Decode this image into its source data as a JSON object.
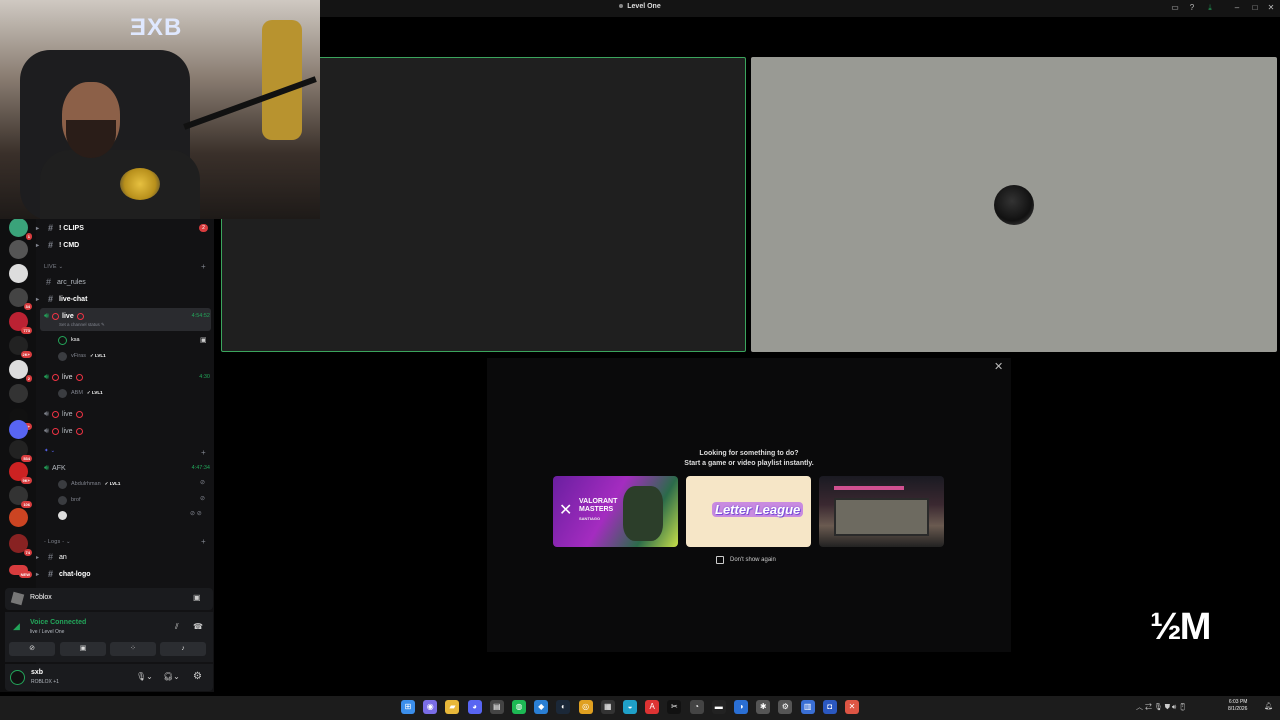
{
  "window": {
    "title": "Level One"
  },
  "webcam": {
    "logo_text": "ƎXB"
  },
  "channels": {
    "clips": "! CLIPS",
    "clips_badge": "2",
    "cmd": "! CMD",
    "live_category": "LIVE",
    "arc_rules": "arc_rules",
    "live_chat": "live-chat",
    "voice1": {
      "name": "live",
      "status": "Set a channel status",
      "time": "4:54:52",
      "users": [
        {
          "name": "ksa"
        },
        {
          "name": "vFiras",
          "level": "LVL1"
        }
      ]
    },
    "voice2": {
      "name": "live",
      "time": "4:30",
      "users": [
        {
          "name": "ABM",
          "level": "LVL1"
        }
      ]
    },
    "voice3": {
      "name": "live"
    },
    "voice4": {
      "name": "live"
    },
    "afk": {
      "name": "AFK",
      "time": "4:47:34",
      "users": [
        {
          "name": "Abdulrhman",
          "level": "LVL1"
        },
        {
          "name": "brof"
        }
      ]
    },
    "logs_category": "- Logs -",
    "an": "an",
    "chat_logo": "chat-logo"
  },
  "server_badges": [
    "1",
    "",
    "",
    "34",
    "773",
    "2K+",
    "2",
    "",
    "8K+",
    "",
    "534",
    "9K+",
    "106",
    "",
    "74",
    "NEW"
  ],
  "activity_bar": {
    "label": "Roblox"
  },
  "voice_panel": {
    "status": "Voice Connected",
    "channel": "live / Level One"
  },
  "user_panel": {
    "username": "sxb",
    "activity": "ROBLOX +1"
  },
  "activity_panel": {
    "line1": "Looking for something to do?",
    "line2": "Start a game or video playlist instantly.",
    "cards": [
      {
        "title": "VALORANT MASTERS",
        "subtitle": "SANTIAGO"
      },
      {
        "title": "Letter League"
      },
      {
        "title": ""
      }
    ],
    "dont_show": "Don't show again"
  },
  "watermark": "½M",
  "clock": {
    "time": "6:03 PM",
    "date": "8/1/2026"
  },
  "colors": {
    "accent_green": "#23a55a",
    "tile_border": "#3ba55d",
    "badge_red": "#d83c3e"
  }
}
